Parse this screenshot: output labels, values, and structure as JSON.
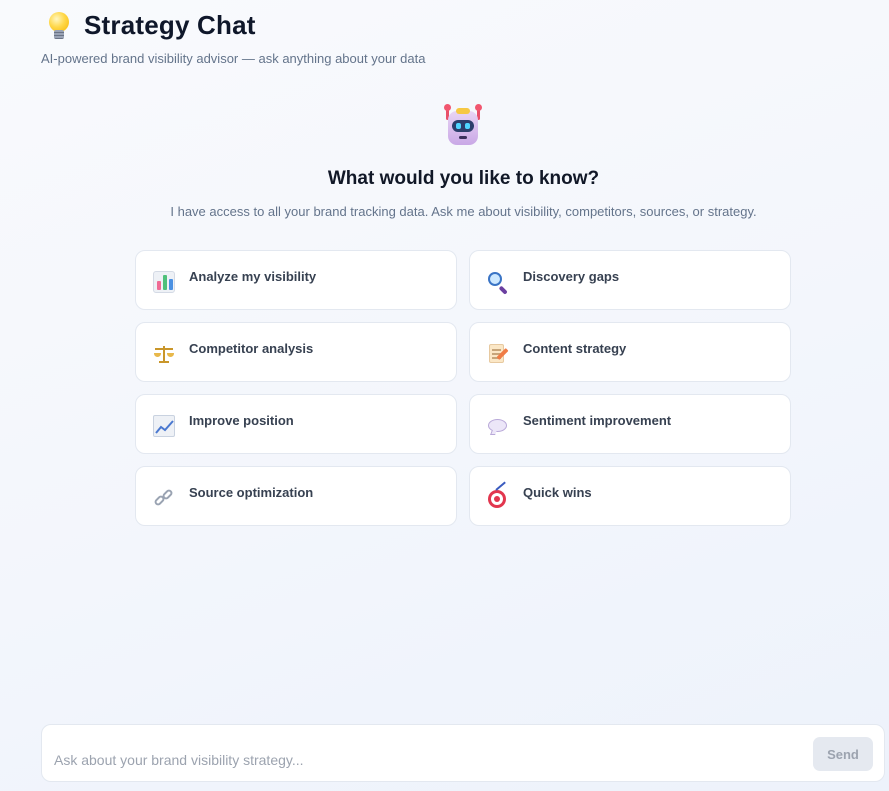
{
  "header": {
    "title": "Strategy Chat",
    "subtitle": "AI-powered brand visibility advisor — ask anything about your data"
  },
  "hero": {
    "title": "What would you like to know?",
    "subtitle": "I have access to all your brand tracking data. Ask me about visibility, competitors, sources, or strategy."
  },
  "suggestions": [
    {
      "label": "Analyze my visibility",
      "icon": "bar-chart-icon"
    },
    {
      "label": "Discovery gaps",
      "icon": "magnifier-icon"
    },
    {
      "label": "Competitor analysis",
      "icon": "balance-scale-icon"
    },
    {
      "label": "Content strategy",
      "icon": "memo-icon"
    },
    {
      "label": "Improve position",
      "icon": "trending-chart-icon"
    },
    {
      "label": "Sentiment improvement",
      "icon": "speech-bubble-icon"
    },
    {
      "label": "Source optimization",
      "icon": "link-icon"
    },
    {
      "label": "Quick wins",
      "icon": "target-icon"
    }
  ],
  "composer": {
    "placeholder": "Ask about your brand visibility strategy...",
    "send_label": "Send"
  },
  "colors": {
    "background": "#f3f6fc",
    "card_border": "#e3e8f0",
    "send_disabled": "#e5e9f0"
  }
}
